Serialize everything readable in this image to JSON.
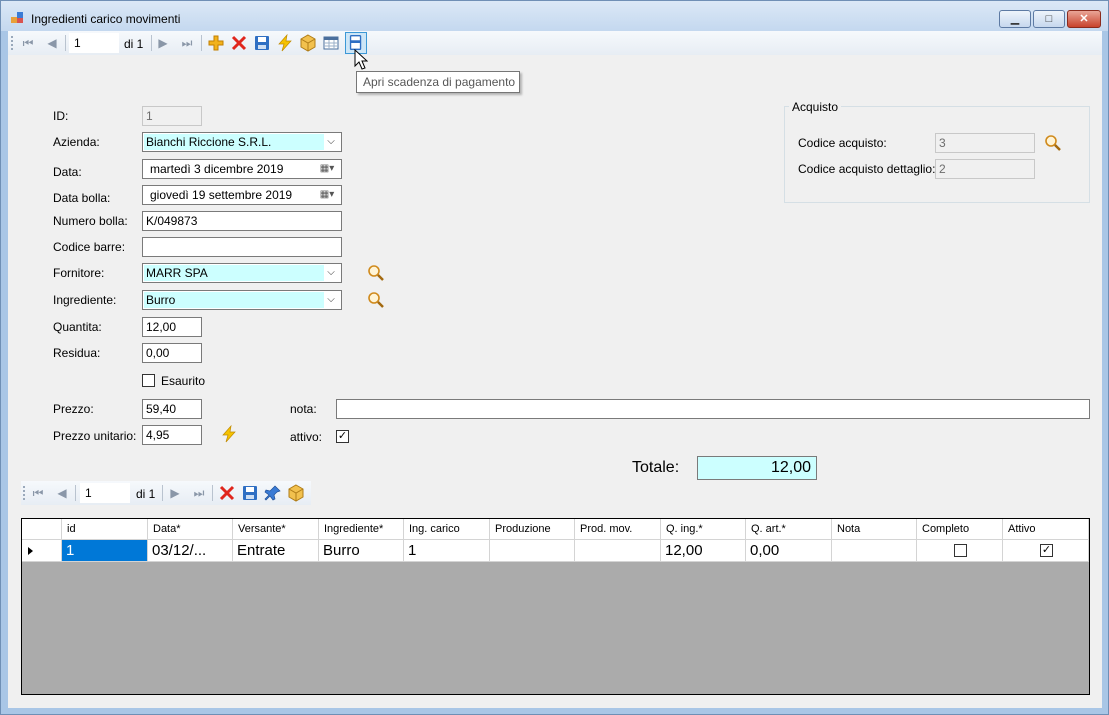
{
  "window": {
    "title": "Ingredienti carico movimenti",
    "minimize": "▁",
    "maximize": "□",
    "close": "✕"
  },
  "main_toolbar": {
    "position": "1",
    "count_label": "di 1",
    "tooltip": "Apri scadenza di pagamento"
  },
  "form": {
    "id_label": "ID:",
    "id_value": "1",
    "azienda_label": "Azienda:",
    "azienda_value": "Bianchi Riccione S.R.L.",
    "data_label": "Data:",
    "data_value": "martedì    3 dicembre  2019",
    "data_bolla_label": "Data bolla:",
    "data_bolla_value": "giovedì   19 settembre  2019",
    "numero_bolla_label": "Numero bolla:",
    "numero_bolla_value": "K/049873",
    "codice_barre_label": "Codice barre:",
    "codice_barre_value": "",
    "fornitore_label": "Fornitore:",
    "fornitore_value": "MARR SPA",
    "ingrediente_label": "Ingrediente:",
    "ingrediente_value": "Burro",
    "quantita_label": "Quantita:",
    "quantita_value": "12,00",
    "residua_label": "Residua:",
    "residua_value": "0,00",
    "esaurito_label": "Esaurito",
    "esaurito_checked": false,
    "prezzo_label": "Prezzo:",
    "prezzo_value": "59,40",
    "prezzo_unitario_label": "Prezzo unitario:",
    "prezzo_unitario_value": "4,95",
    "nota_label": "nota:",
    "nota_value": "",
    "attivo_label": "attivo:",
    "attivo_checked": true,
    "totale_label": "Totale:",
    "totale_value": "12,00"
  },
  "acquisto": {
    "title": "Acquisto",
    "codice_acquisto_label": "Codice acquisto:",
    "codice_acquisto_value": "3",
    "codice_dettaglio_label": "Codice acquisto dettaglio:",
    "codice_dettaglio_value": "2"
  },
  "detail_toolbar": {
    "position": "1",
    "count_label": "di 1"
  },
  "grid": {
    "columns": [
      "id",
      "Data*",
      "Versante*",
      "Ingrediente*",
      "Ing. carico",
      "Produzione",
      "Prod. mov.",
      "Q. ing.*",
      "Q. art.*",
      "Nota",
      "Completo",
      "Attivo"
    ],
    "rows": [
      {
        "id": "1",
        "data": "03/12/...",
        "versante": "Entrate",
        "ingrediente": "Burro",
        "ing_carico": "1",
        "produzione": "",
        "prod_mov": "",
        "q_ing": "12,00",
        "q_art": "0,00",
        "nota": "",
        "completo": false,
        "attivo": true
      }
    ]
  },
  "colors": {
    "highlight_field": "#ccffff",
    "selection": "#0078d7",
    "grid_background": "#ababab"
  }
}
